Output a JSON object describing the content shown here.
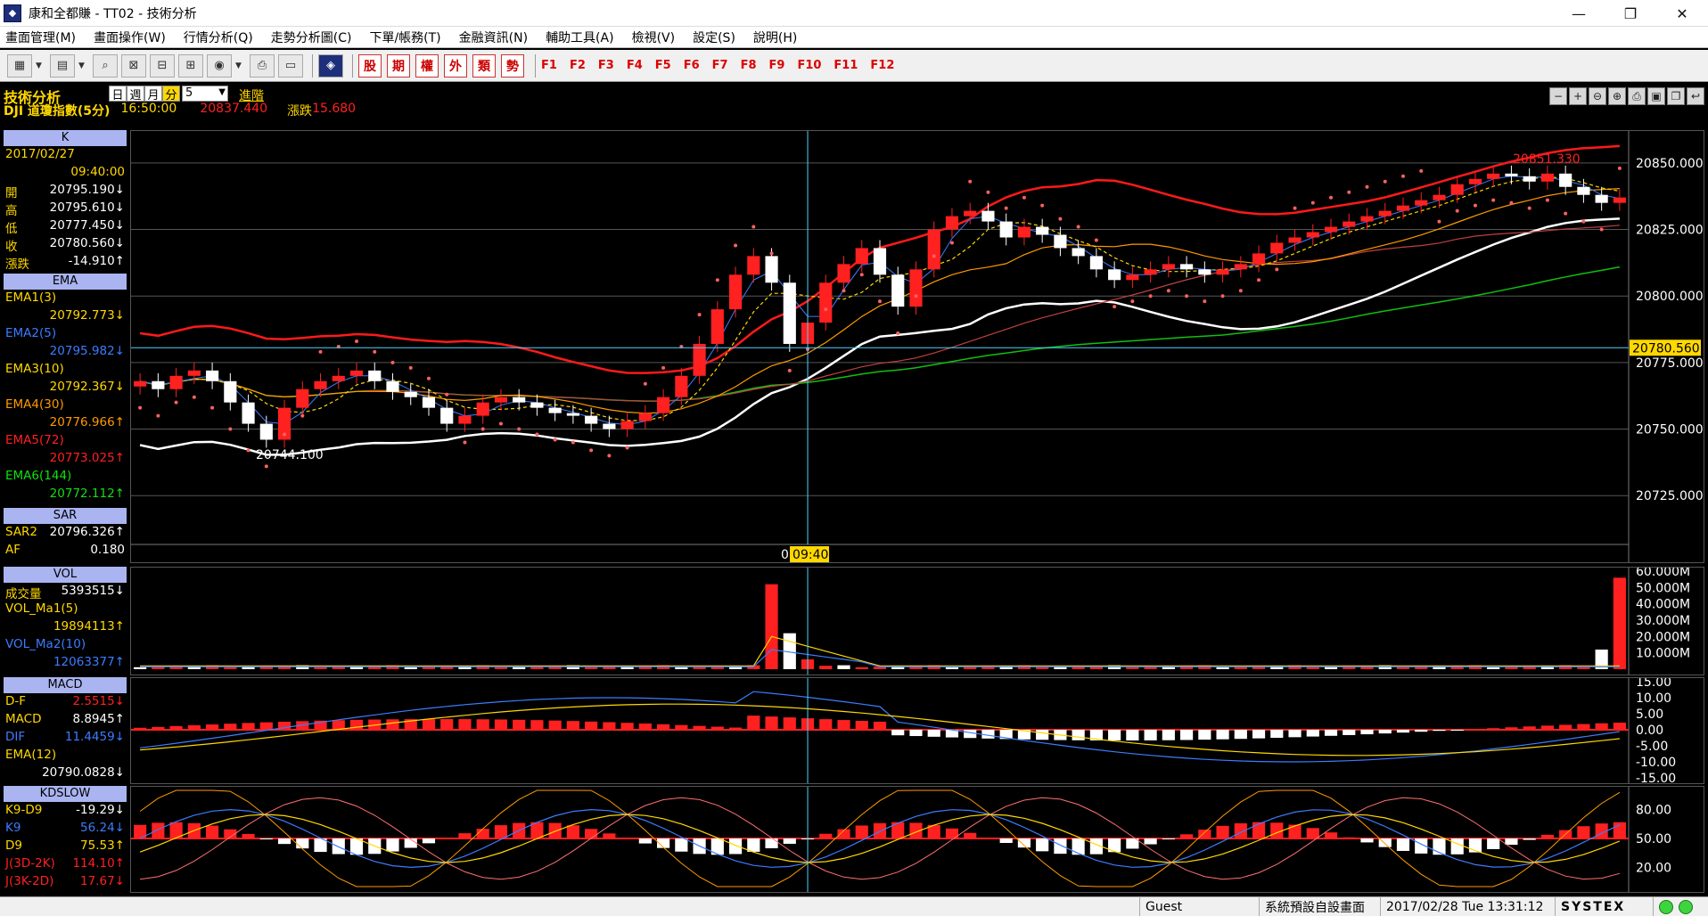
{
  "window": {
    "title": "康和全都賺 - TT02 - 技術分析",
    "icon": "app-logo-icon"
  },
  "menu": [
    "畫面管理(M)",
    "畫面操作(W)",
    "行情分析(Q)",
    "走勢分析圖(C)",
    "下單/帳務(T)",
    "金融資訊(N)",
    "輔助工具(A)",
    "檢視(V)",
    "設定(S)",
    "說明(H)"
  ],
  "toolbar": {
    "cn_buttons": [
      "股",
      "期",
      "權",
      "外",
      "類",
      "勢"
    ],
    "f_keys": [
      "F1",
      "F2",
      "F3",
      "F4",
      "F5",
      "F6",
      "F7",
      "F8",
      "F9",
      "F10",
      "F11",
      "F12"
    ]
  },
  "header": {
    "module_title": "技術分析",
    "period_tabs": [
      "日",
      "週",
      "月",
      "分"
    ],
    "period_active": "分",
    "period_value": "5",
    "advanced": "進階",
    "symbol": "DJI 道瓊指數(5分)",
    "time": "16:50:00",
    "price": "20837.440",
    "change_label": "漲跌",
    "change": "15.680"
  },
  "panels": {
    "k": {
      "title": "K",
      "date": "2017/02/27",
      "time": "09:40:00",
      "rows": [
        {
          "label": "開",
          "value": "20795.190↓"
        },
        {
          "label": "高",
          "value": "20795.610↓"
        },
        {
          "label": "低",
          "value": "20777.450↓"
        },
        {
          "label": "收",
          "value": "20780.560↓"
        },
        {
          "label": "漲跌",
          "value": "-14.910↑"
        }
      ]
    },
    "ema": {
      "title": "EMA",
      "rows": [
        {
          "label": "EMA1(3)",
          "value": "20792.773↓"
        },
        {
          "label": "EMA2(5)",
          "value": "20795.982↓"
        },
        {
          "label": "EMA3(10)",
          "value": "20792.367↓"
        },
        {
          "label": "EMA4(30)",
          "value": "20776.966↑"
        },
        {
          "label": "EMA5(72)",
          "value": "20773.025↑"
        },
        {
          "label": "EMA6(144)",
          "value": "20772.112↑"
        }
      ]
    },
    "sar": {
      "title": "SAR",
      "rows": [
        {
          "label": "SAR2",
          "value": "20796.326↑"
        },
        {
          "label": "AF",
          "value": "0.180"
        }
      ]
    },
    "vol": {
      "title": "VOL",
      "rows": [
        {
          "label": "成交量",
          "value": "5393515↓"
        },
        {
          "label": "VOL_Ma1(5)",
          "value": "19894113↑"
        },
        {
          "label": "VOL_Ma2(10)",
          "value": "12063377↑"
        }
      ]
    },
    "macd": {
      "title": "MACD",
      "rows": [
        {
          "label": "D-F",
          "value": "2.5515↓"
        },
        {
          "label": "MACD",
          "value": "8.8945↑"
        },
        {
          "label": "DIF",
          "value": "11.4459↓"
        },
        {
          "label": "EMA(12)",
          "value": "20790.0828↓"
        }
      ]
    },
    "kd": {
      "title": "KDSLOW",
      "rows": [
        {
          "label": "K9-D9",
          "value": "-19.29↓"
        },
        {
          "label": "K9",
          "value": "56.24↓"
        },
        {
          "label": "D9",
          "value": "75.53↑"
        },
        {
          "label": "J(3D-2K)",
          "value": "114.10↑"
        },
        {
          "label": "J(3K-2D)",
          "value": "17.67↓"
        }
      ]
    }
  },
  "chart_data": [
    {
      "type": "candlestick",
      "title": "",
      "ylim": [
        20710,
        20860
      ],
      "yticks": [
        "20850.000",
        "20825.000",
        "20800.000",
        "20775.000",
        "20750.000",
        "20725.000"
      ],
      "current_price_label": "20780.560",
      "high_annotation": "20851.330",
      "low_annotation": "20744.100",
      "crosshair_time_label": "09:40",
      "crosshair_time_prefix": "0",
      "close_series": [
        20768,
        20765,
        20770,
        20772,
        20768,
        20760,
        20752,
        20746,
        20758,
        20765,
        20768,
        20770,
        20772,
        20768,
        20764,
        20762,
        20758,
        20752,
        20755,
        20760,
        20762,
        20760,
        20758,
        20756,
        20755,
        20752,
        20750,
        20753,
        20756,
        20762,
        20770,
        20782,
        20795,
        20808,
        20815,
        20805,
        20782,
        20790,
        20805,
        20812,
        20818,
        20808,
        20796,
        20810,
        20825,
        20830,
        20832,
        20828,
        20822,
        20826,
        20823,
        20818,
        20815,
        20810,
        20806,
        20808,
        20810,
        20812,
        20810,
        20808,
        20810,
        20812,
        20816,
        20820,
        20822,
        20824,
        20826,
        20828,
        20830,
        20832,
        20834,
        20836,
        20838,
        20842,
        20844,
        20846,
        20845,
        20843,
        20846,
        20841,
        20838,
        20835,
        20837
      ],
      "grid": true
    },
    {
      "type": "bar",
      "title": "VOL",
      "yticks": [
        "60.000M",
        "50.000M",
        "40.000M",
        "30.000M",
        "20.000M",
        "10.000M"
      ],
      "ylim": [
        0,
        60
      ]
    },
    {
      "type": "bar",
      "title": "MACD",
      "yticks": [
        "15.00",
        "10.00",
        "5.00",
        "0.00",
        "-5.00",
        "-10.00",
        "-15.00"
      ],
      "ylim": [
        -15,
        15
      ]
    },
    {
      "type": "line",
      "title": "KDSLOW",
      "yticks": [
        "80.00",
        "50.00",
        "20.00"
      ],
      "ylim": [
        0,
        100
      ]
    }
  ],
  "statusbar": {
    "user": "Guest",
    "layout": "系統預設自設畫面",
    "datetime": "2017/02/28 Tue 13:31:12",
    "brand": "SYSTEX"
  },
  "colors": {
    "up": "#ff2020",
    "down": "#ffffff",
    "label": "#ffd800",
    "header": "#aab4f0"
  }
}
